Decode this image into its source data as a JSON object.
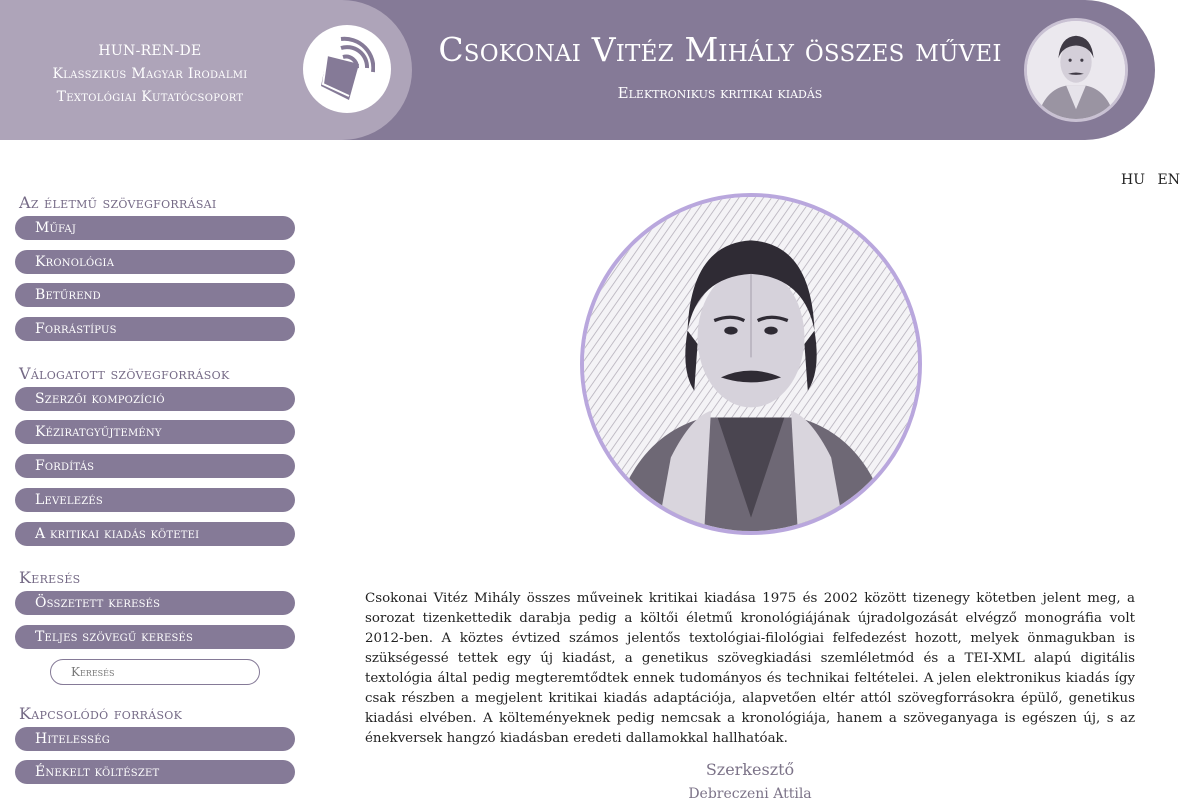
{
  "header": {
    "org_line1": "HUN-REN-DE",
    "org_line2": "Klasszikus Magyar Irodalmi",
    "org_line3": "Textológiai Kutatócsoport",
    "title": "Csokonai Vitéz Mihály összes művei",
    "subtitle": "Elektronikus kritikai kiadás",
    "logo_icon": "quill-book-icon",
    "portrait_icon": "portrait-icon"
  },
  "lang": {
    "hu": "HU",
    "en": "EN"
  },
  "sidebar": {
    "sections": [
      {
        "title": "Az életmű szövegforrásai",
        "items": [
          "Műfaj",
          "Kronológia",
          "Betűrend",
          "Forrástípus"
        ]
      },
      {
        "title": "Válogatott szövegforrások",
        "items": [
          "Szerzői kompozíció",
          "Kéziratgyűjtemény",
          "Fordítás",
          "Levelezés",
          "A kritikai kiadás kötetei"
        ]
      },
      {
        "title": "Keresés",
        "items": [
          "Összetett keresés",
          "Teljes szövegű keresés"
        ]
      },
      {
        "title": "Kapcsolódó források",
        "items": [
          "Hitelesség",
          "Énekelt költészet"
        ]
      }
    ],
    "search_placeholder": "Keresés"
  },
  "main": {
    "intro": "Csokonai Vitéz Mihály összes műveinek kritikai kiadása 1975 és 2002 között tizenegy kötetben jelent meg, a sorozat tizenkettedik darabja pedig a költői életmű kronológiájának újradolgozását elvégző monográfia volt 2012-ben. A köztes évtized számos jelentős textológiai-filológiai felfedezést hozott, melyek önmagukban is szükségessé tettek egy új kiadást, a genetikus szövegkiadási szemléletmód és a TEI-XML alapú digitális textológia által pedig megteremtődtek ennek tudományos és technikai feltételei. A jelen elektronikus kiadás így csak részben a megjelent kritikai kiadás adaptációja, alapvetően eltér attól szövegforrásokra épülő, genetikus kiadási elvében. A költeményeknek pedig nemcsak a kronológiája, hanem a szöveganyaga is egészen új, s az énekversek hangzó kiadásban eredeti dallamokkal hallhatóak.",
    "editor_label": "Szerkesztő",
    "editor_name": "Debreczeni Attila"
  },
  "colors": {
    "header_dark": "#857a97",
    "header_light": "#aea4b9",
    "accent_ring": "#b9a7dd"
  }
}
